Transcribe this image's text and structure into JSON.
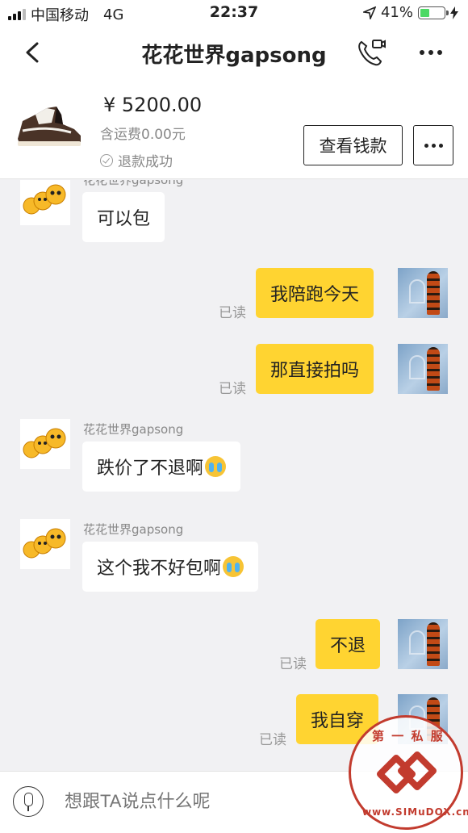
{
  "status_bar": {
    "carrier": "中国移动",
    "network": "4G",
    "time": "22:37",
    "battery": "41%"
  },
  "nav": {
    "title": "花花世界gapsong"
  },
  "product": {
    "price": "¥ 5200.00",
    "shipping": "含运费0.00元",
    "status": "退款成功",
    "view_button": "查看钱款"
  },
  "messages": [
    {
      "side": "in",
      "sender": "花花世界gapsong",
      "text": "可以包",
      "has_emoji": false
    },
    {
      "side": "out",
      "text": "我陪跑今天",
      "read": "已读"
    },
    {
      "side": "out",
      "text": "那直接拍吗",
      "read": "已读"
    },
    {
      "side": "in",
      "sender": "花花世界gapsong",
      "text": "跌价了不退啊",
      "has_emoji": true
    },
    {
      "side": "in",
      "sender": "花花世界gapsong",
      "text": "这个我不好包啊",
      "has_emoji": true
    },
    {
      "side": "out",
      "text": "不退",
      "read": "已读"
    },
    {
      "side": "out",
      "text": "我自穿",
      "read": "已读"
    }
  ],
  "input": {
    "placeholder": "想跟TA说点什么呢"
  },
  "watermark": {
    "text_top": "第 一 私 服",
    "text_bottom": "www.SIMuDOX.cn"
  },
  "colors": {
    "accent": "#ffd431",
    "background": "#f1f1f3"
  }
}
